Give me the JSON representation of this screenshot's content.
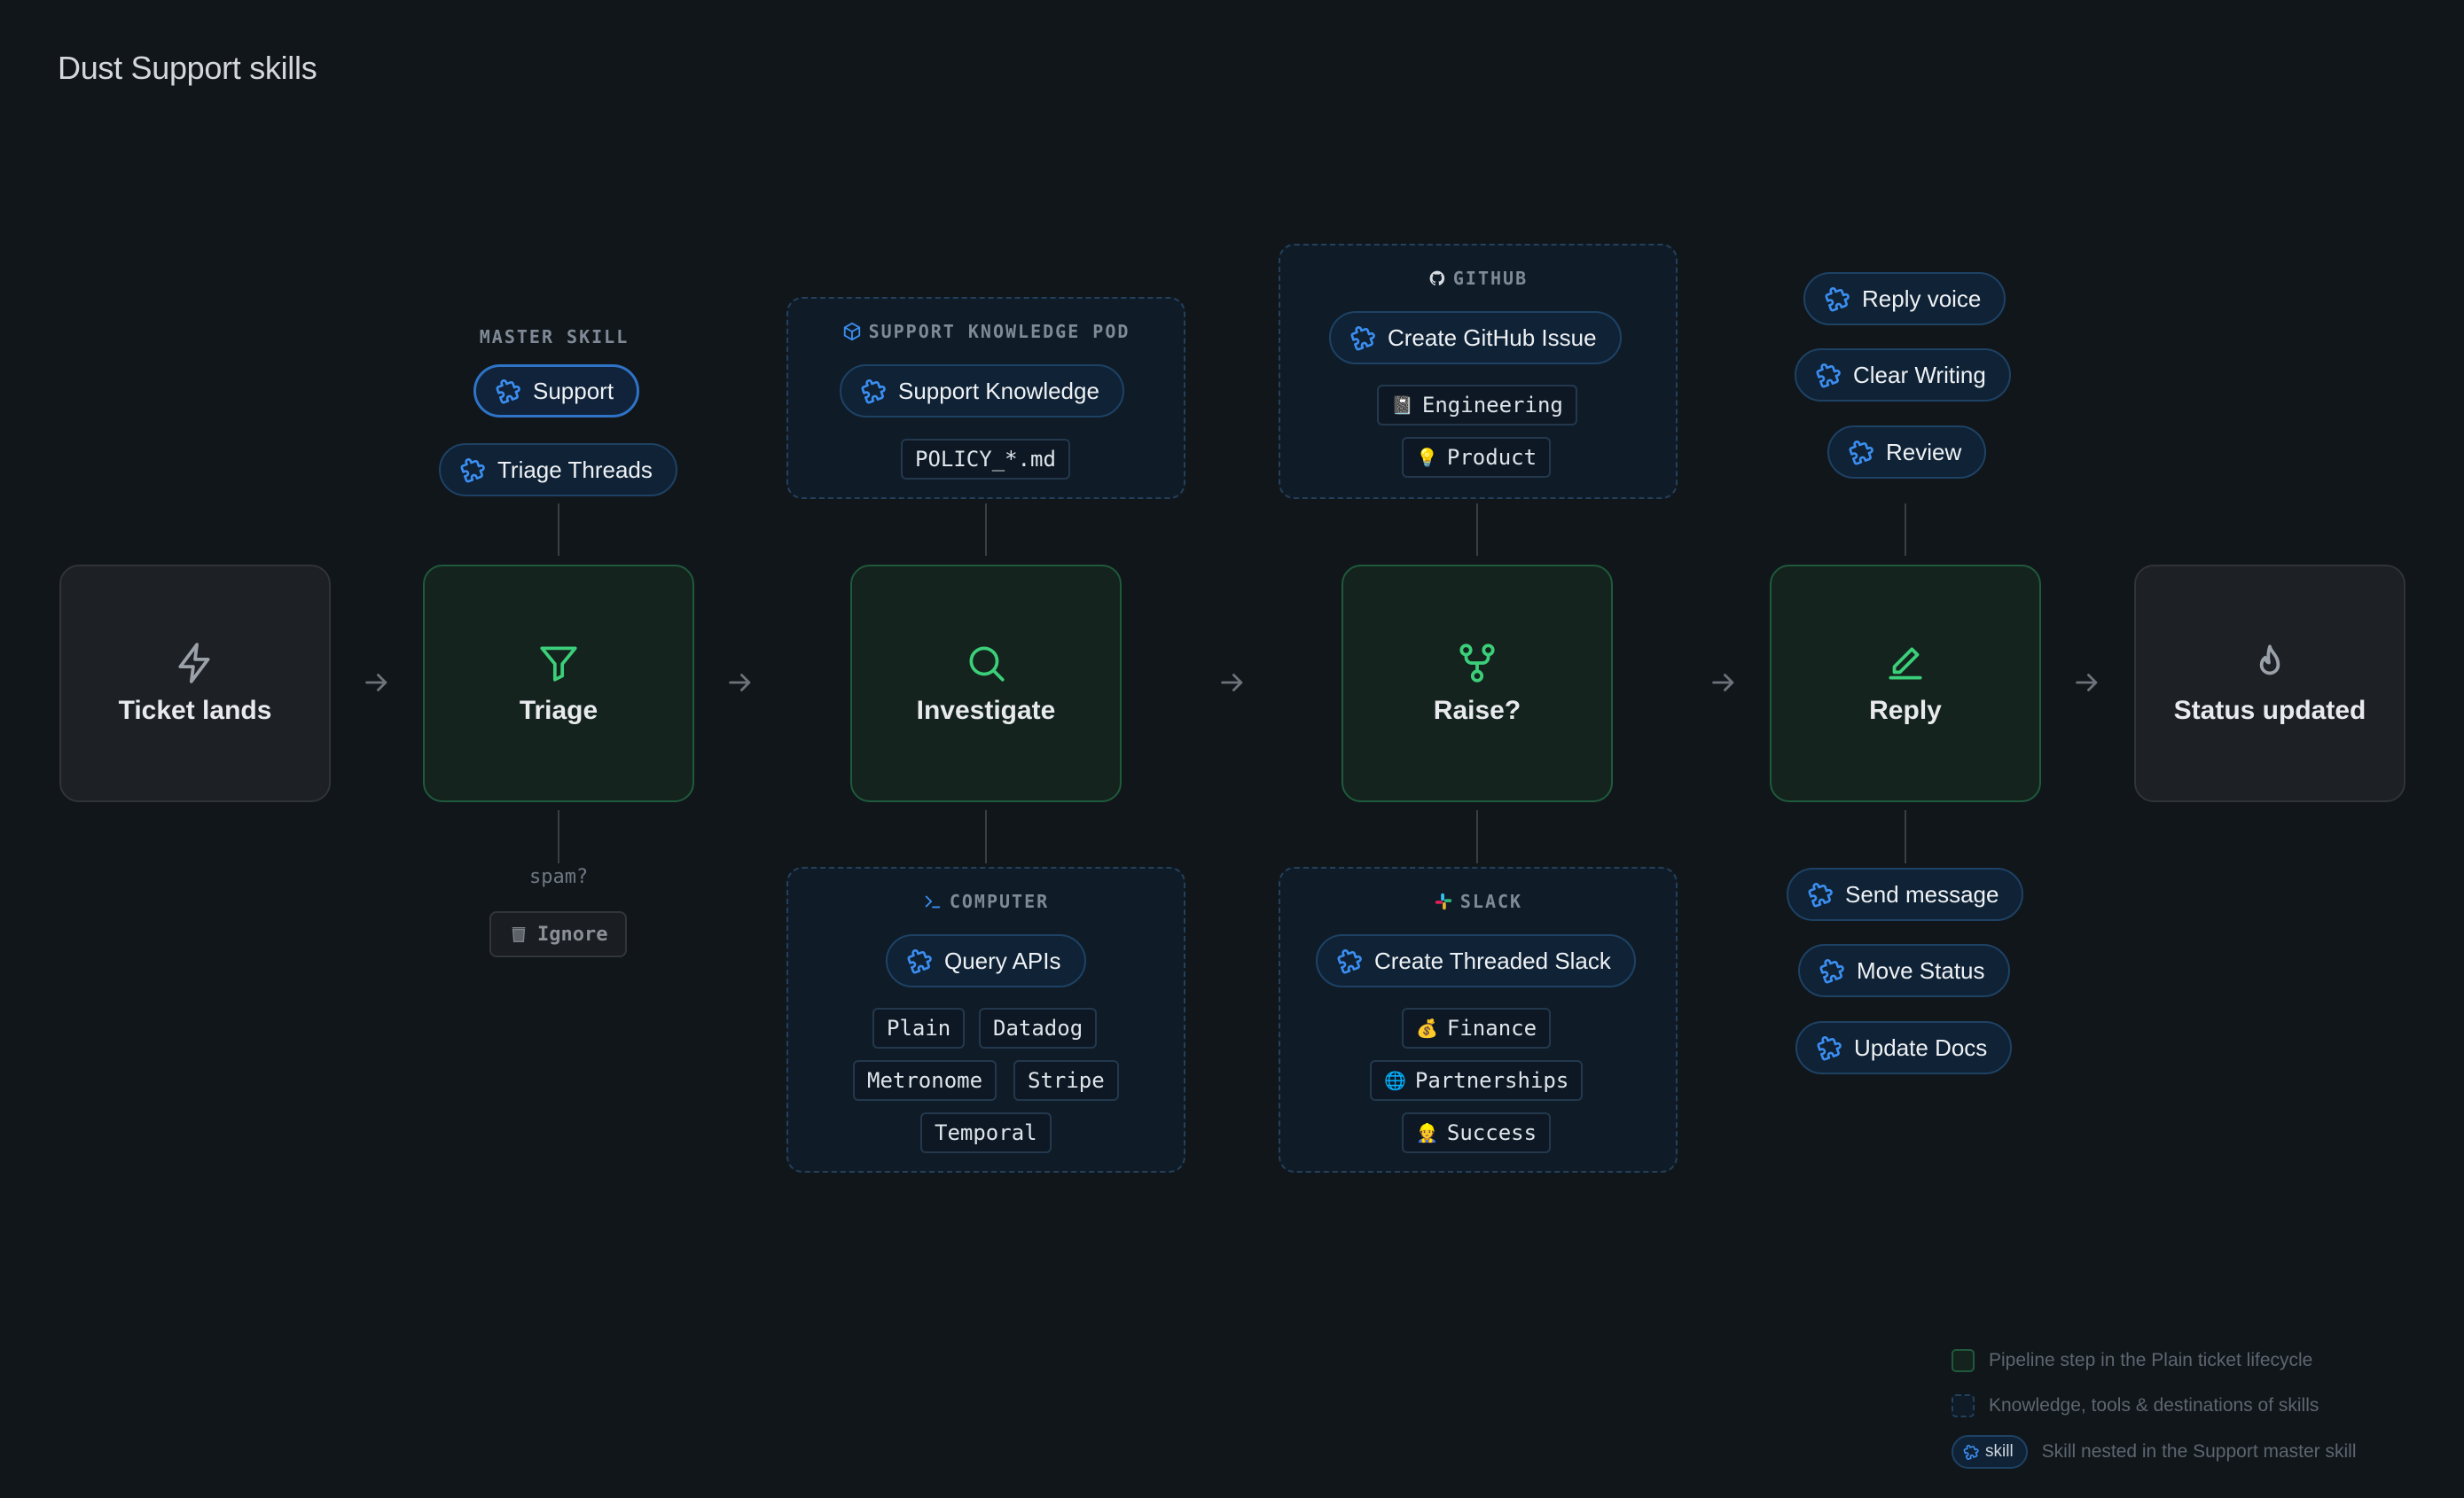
{
  "page": {
    "title": "Dust Support skills"
  },
  "colors": {
    "background": "#11161b",
    "step_green_bg": "#14231d",
    "step_green_border": "#1f5a3c",
    "step_neutral_bg": "#1d2025",
    "skill_blue": "#2f73c6",
    "icon_green": "#3ccf7a"
  },
  "steps": [
    {
      "label": "Ticket lands",
      "icon": "lightning-icon"
    },
    {
      "label": "Triage",
      "icon": "filter-icon"
    },
    {
      "label": "Investigate",
      "icon": "magnifier-icon"
    },
    {
      "label": "Raise?",
      "icon": "branch-icon"
    },
    {
      "label": "Reply",
      "icon": "pencil-icon"
    },
    {
      "label": "Status updated",
      "icon": "flame-icon"
    }
  ],
  "triage": {
    "section_label": "MASTER SKILL",
    "master_skill": "Support",
    "skill": "Triage Threads",
    "spam_label": "spam?",
    "ignore_label": "Ignore"
  },
  "knowledge_pod": {
    "header": "SUPPORT KNOWLEDGE POD",
    "skill": "Support Knowledge",
    "tag": "POLICY_*.md"
  },
  "computer": {
    "header": "COMPUTER",
    "skill": "Query APIs",
    "tags": [
      "Plain",
      "Datadog",
      "Metronome",
      "Stripe",
      "Temporal"
    ]
  },
  "github": {
    "header": "GITHUB",
    "skill": "Create GitHub Issue",
    "tags": [
      {
        "emoji": "📓",
        "label": "Engineering"
      },
      {
        "emoji": "💡",
        "label": "Product"
      }
    ]
  },
  "slack": {
    "header": "SLACK",
    "skill": "Create Threaded Slack",
    "tags": [
      {
        "emoji": "💰",
        "label": "Finance"
      },
      {
        "emoji": "🌐",
        "label": "Partnerships"
      },
      {
        "emoji": "👷",
        "label": "Success"
      }
    ]
  },
  "reply_top_skills": [
    "Reply voice",
    "Clear Writing",
    "Review"
  ],
  "reply_bottom_skills": [
    "Send message",
    "Move Status",
    "Update Docs"
  ],
  "legend": {
    "pipeline_step": "Pipeline step in the Plain ticket lifecycle",
    "knowledge_tools": "Knowledge, tools & destinations of skills",
    "skill_pill": "skill",
    "skill_nested": "Skill nested in the Support master skill"
  }
}
